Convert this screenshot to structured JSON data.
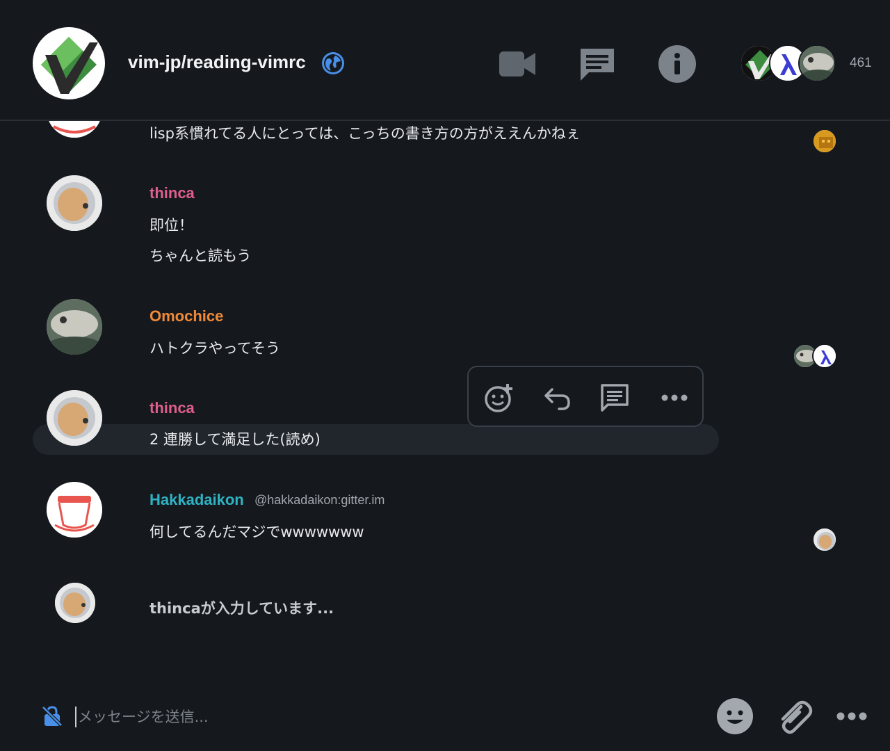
{
  "header": {
    "room_name": "vim-jp/reading-vimrc",
    "member_count": "461",
    "icons": [
      "globe-icon",
      "video-call-icon",
      "threads-icon",
      "room-info-icon"
    ]
  },
  "messages": [
    {
      "body": "lisp系慣れてる人にとっては、こっちの書き方の方がええんかねぇ"
    },
    {
      "sender": "thinca",
      "sender_color": "#e05e8c",
      "lines": [
        "即位！",
        "ちゃんと読もう"
      ]
    },
    {
      "sender": "Omochice",
      "sender_color": "#f08a38",
      "lines": [
        "ハトクラやってそう"
      ]
    },
    {
      "sender": "thinca",
      "sender_color": "#e05e8c",
      "lines": [
        "2 連勝して満足した(読め)"
      ]
    },
    {
      "sender": "Hakkadaikon",
      "sender_color": "#2fb3c4",
      "handle": "@hakkadaikon:gitter.im",
      "lines": [
        "何してるんだマジでwwwwwww"
      ]
    }
  ],
  "typing": "thincaが入力しています...",
  "action_bar": [
    "react-icon",
    "reply-icon",
    "thread-icon",
    "options-icon"
  ],
  "composer": {
    "placeholder": "メッセージを送信...",
    "icons": [
      "unencrypted-icon",
      "emoji-icon",
      "attachment-icon",
      "more-options-icon"
    ]
  },
  "colors": {
    "background": "#15191e",
    "accent": "#4a8fe7"
  }
}
